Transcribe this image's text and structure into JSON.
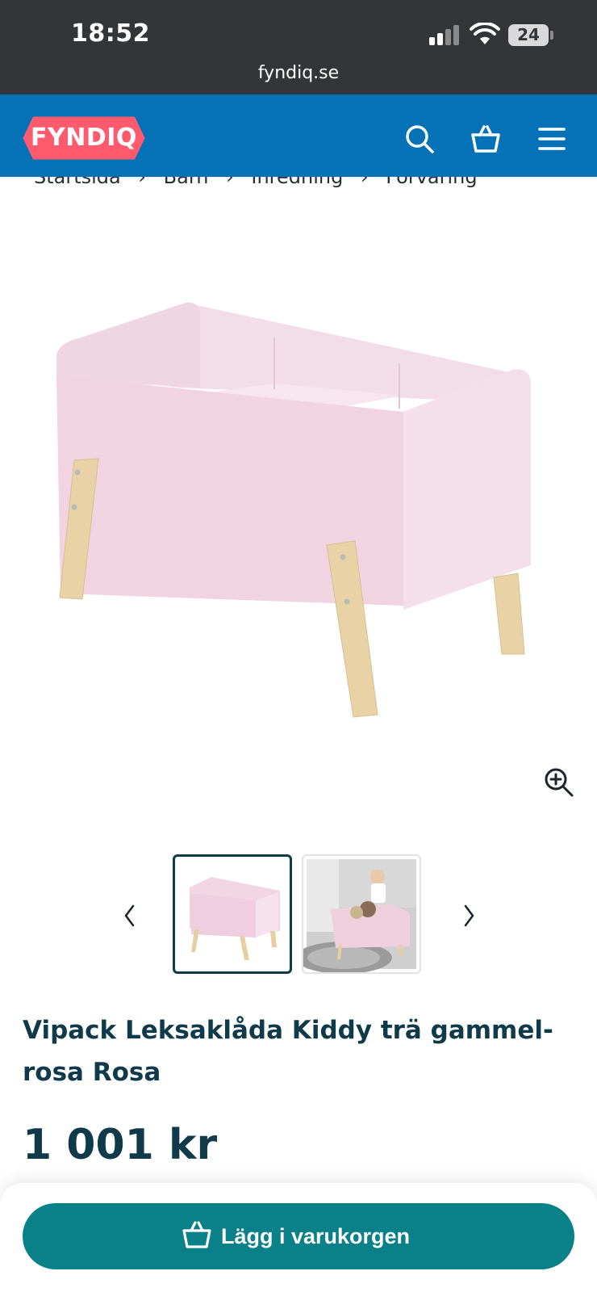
{
  "status_bar": {
    "time": "18:52",
    "battery": "24",
    "url": "fyndiq.se"
  },
  "header": {
    "logo_text": "FYNDIQ",
    "logo_color": "#ff5a6e",
    "bar_color": "#0572b8",
    "icons": [
      "search-icon",
      "cart-icon",
      "menu-icon"
    ]
  },
  "breadcrumb": {
    "items": [
      "Startsida",
      "Barn",
      "Inredning",
      "Förvaring"
    ],
    "separator": "›"
  },
  "gallery": {
    "zoom_icon": "zoom-in-icon",
    "prev_icon": "chevron-left-icon",
    "next_icon": "chevron-right-icon",
    "thumbnails": [
      "product-photo",
      "lifestyle-photo"
    ],
    "active_index": 0
  },
  "product": {
    "title": "Vipack Leksaklåda Kiddy trä gammel-rosa Rosa",
    "price": "1 001 kr"
  },
  "actions": {
    "add_to_cart_label": "Lägg i varukorgen",
    "button_color": "#0a8189"
  }
}
